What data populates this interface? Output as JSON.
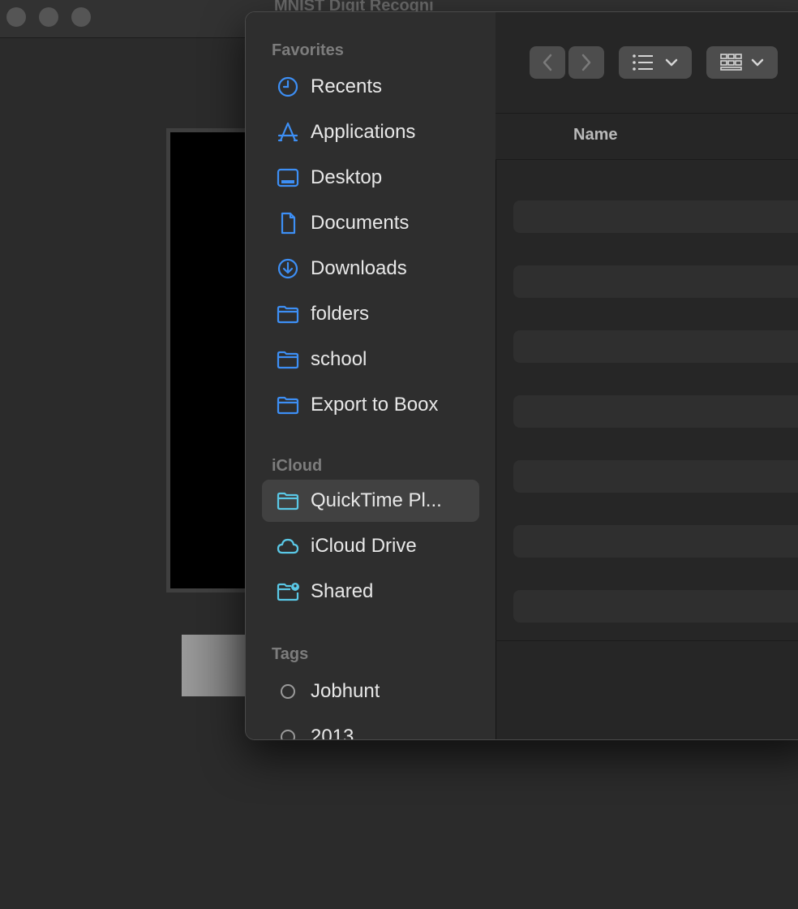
{
  "window": {
    "title": "MNIST Digit Recogni"
  },
  "toolbar": {
    "back_label": "Back",
    "forward_label": "Forward"
  },
  "list": {
    "name_header": "Name",
    "placeholder_rows": 7
  },
  "sidebar": {
    "favorites_title": "Favorites",
    "favorites": [
      {
        "label": "Recents",
        "icon": "clock-icon"
      },
      {
        "label": "Applications",
        "icon": "applications-icon"
      },
      {
        "label": "Desktop",
        "icon": "desktop-icon"
      },
      {
        "label": "Documents",
        "icon": "document-icon"
      },
      {
        "label": "Downloads",
        "icon": "download-icon"
      },
      {
        "label": "folders",
        "icon": "folder-icon"
      },
      {
        "label": "school",
        "icon": "folder-icon"
      },
      {
        "label": "Export to Boox",
        "icon": "folder-icon"
      }
    ],
    "icloud_title": "iCloud",
    "icloud": [
      {
        "label": "QuickTime Pl...",
        "icon": "folder-icon",
        "selected": true
      },
      {
        "label": "iCloud Drive",
        "icon": "cloud-icon"
      },
      {
        "label": "Shared",
        "icon": "shared-folder-icon"
      }
    ],
    "tags_title": "Tags",
    "tags": [
      {
        "label": "Jobhunt",
        "icon": "tag-circle-icon"
      },
      {
        "label": "2013",
        "icon": "tag-circle-icon"
      }
    ]
  },
  "colors": {
    "accent": "#3d8ff5",
    "icloud_accent": "#5ac8e6",
    "tag": "#9a9a9a"
  }
}
